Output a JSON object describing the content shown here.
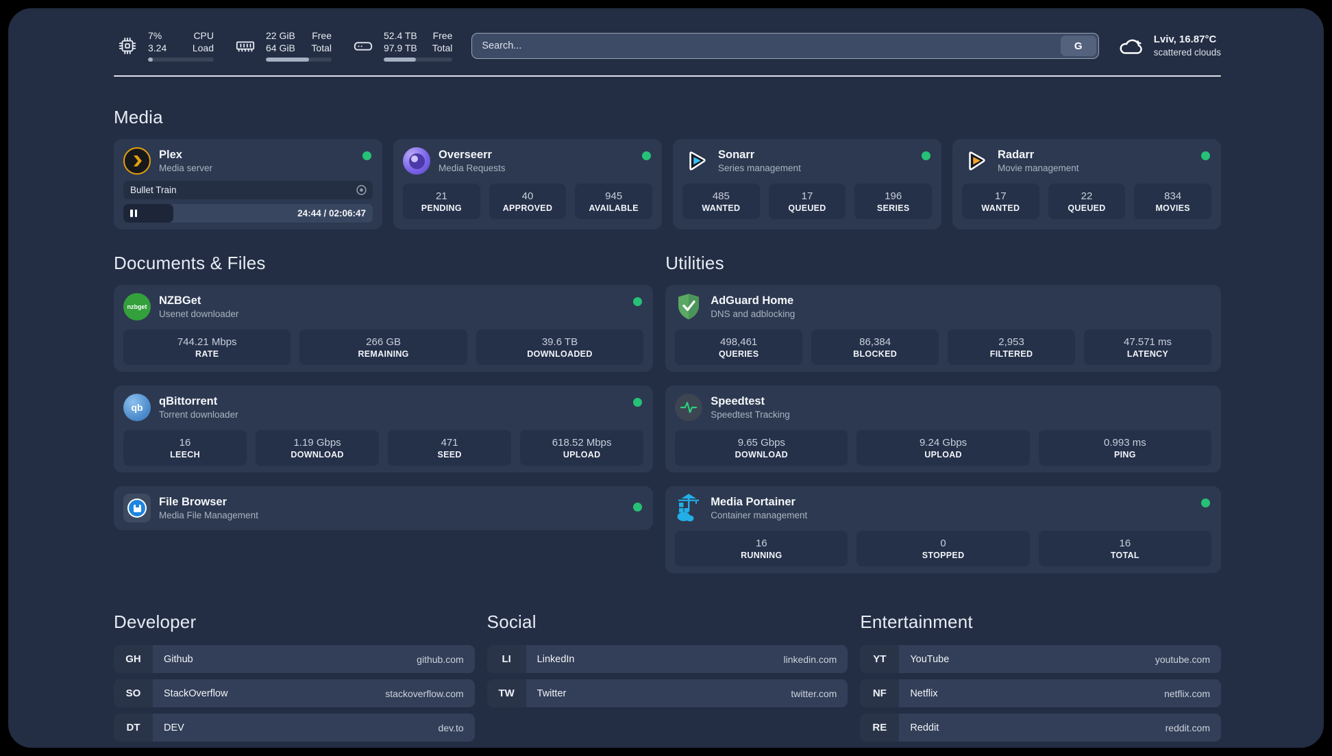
{
  "header": {
    "metrics": [
      {
        "icon": "cpu",
        "value_line1": "7%",
        "value_line2": "3.24",
        "label_line1": "CPU",
        "label_line2": "Load",
        "progress_pct": 7
      },
      {
        "icon": "memory",
        "value_line1": "22 GiB",
        "value_line2": "64 GiB",
        "label_line1": "Free",
        "label_line2": "Total",
        "progress_pct": 66
      },
      {
        "icon": "disk",
        "value_line1": "52.4 TB",
        "value_line2": "97.9 TB",
        "label_line1": "Free",
        "label_line2": "Total",
        "progress_pct": 47
      }
    ],
    "search": {
      "placeholder": "Search...",
      "button_label": "G"
    },
    "weather": {
      "summary": "Lviv, 16.87°C",
      "condition": "scattered clouds"
    }
  },
  "sections": {
    "media": {
      "title": "Media",
      "plex": {
        "name": "Plex",
        "description": "Media server",
        "now_playing": "Bullet Train",
        "time_display": "24:44 / 02:06:47",
        "progress_pct": 20
      },
      "overseerr": {
        "name": "Overseerr",
        "description": "Media Requests",
        "stats": [
          {
            "value": "21",
            "label": "PENDING"
          },
          {
            "value": "40",
            "label": "APPROVED"
          },
          {
            "value": "945",
            "label": "AVAILABLE"
          }
        ]
      },
      "sonarr": {
        "name": "Sonarr",
        "description": "Series management",
        "stats": [
          {
            "value": "485",
            "label": "WANTED"
          },
          {
            "value": "17",
            "label": "QUEUED"
          },
          {
            "value": "196",
            "label": "SERIES"
          }
        ]
      },
      "radarr": {
        "name": "Radarr",
        "description": "Movie management",
        "stats": [
          {
            "value": "17",
            "label": "WANTED"
          },
          {
            "value": "22",
            "label": "QUEUED"
          },
          {
            "value": "834",
            "label": "MOVIES"
          }
        ]
      }
    },
    "documents": {
      "title": "Documents & Files",
      "nzbget": {
        "name": "NZBGet",
        "description": "Usenet downloader",
        "stats": [
          {
            "value": "744.21 Mbps",
            "label": "RATE"
          },
          {
            "value": "266 GB",
            "label": "REMAINING"
          },
          {
            "value": "39.6 TB",
            "label": "DOWNLOADED"
          }
        ]
      },
      "qbittorrent": {
        "name": "qBittorrent",
        "description": "Torrent downloader",
        "stats": [
          {
            "value": "16",
            "label": "LEECH"
          },
          {
            "value": "1.19 Gbps",
            "label": "DOWNLOAD"
          },
          {
            "value": "471",
            "label": "SEED"
          },
          {
            "value": "618.52 Mbps",
            "label": "UPLOAD"
          }
        ]
      },
      "filebrowser": {
        "name": "File Browser",
        "description": "Media File Management"
      }
    },
    "utilities": {
      "title": "Utilities",
      "adguard": {
        "name": "AdGuard Home",
        "description": "DNS and adblocking",
        "stats": [
          {
            "value": "498,461",
            "label": "QUERIES"
          },
          {
            "value": "86,384",
            "label": "BLOCKED"
          },
          {
            "value": "2,953",
            "label": "FILTERED"
          },
          {
            "value": "47.571 ms",
            "label": "LATENCY"
          }
        ]
      },
      "speedtest": {
        "name": "Speedtest",
        "description": "Speedtest Tracking",
        "stats": [
          {
            "value": "9.65 Gbps",
            "label": "DOWNLOAD"
          },
          {
            "value": "9.24 Gbps",
            "label": "UPLOAD"
          },
          {
            "value": "0.993 ms",
            "label": "PING"
          }
        ]
      },
      "portainer": {
        "name": "Media Portainer",
        "description": "Container management",
        "stats": [
          {
            "value": "16",
            "label": "RUNNING"
          },
          {
            "value": "0",
            "label": "STOPPED"
          },
          {
            "value": "16",
            "label": "TOTAL"
          }
        ]
      }
    },
    "links": {
      "developer": {
        "title": "Developer",
        "items": [
          {
            "abbr": "GH",
            "name": "Github",
            "url": "github.com"
          },
          {
            "abbr": "SO",
            "name": "StackOverflow",
            "url": "stackoverflow.com"
          },
          {
            "abbr": "DT",
            "name": "DEV",
            "url": "dev.to"
          }
        ]
      },
      "social": {
        "title": "Social",
        "items": [
          {
            "abbr": "LI",
            "name": "LinkedIn",
            "url": "linkedin.com"
          },
          {
            "abbr": "TW",
            "name": "Twitter",
            "url": "twitter.com"
          }
        ]
      },
      "entertainment": {
        "title": "Entertainment",
        "items": [
          {
            "abbr": "YT",
            "name": "YouTube",
            "url": "youtube.com"
          },
          {
            "abbr": "NF",
            "name": "Netflix",
            "url": "netflix.com"
          },
          {
            "abbr": "RE",
            "name": "Reddit",
            "url": "reddit.com"
          }
        ]
      }
    }
  },
  "colors": {
    "status_online": "#27c077",
    "plex_accent": "#e5a00d",
    "sonarr_accent": "#38c1f2",
    "radarr_accent": "#f5a623",
    "portainer_accent": "#22aee6",
    "speedtest_accent": "#2ad17c"
  }
}
